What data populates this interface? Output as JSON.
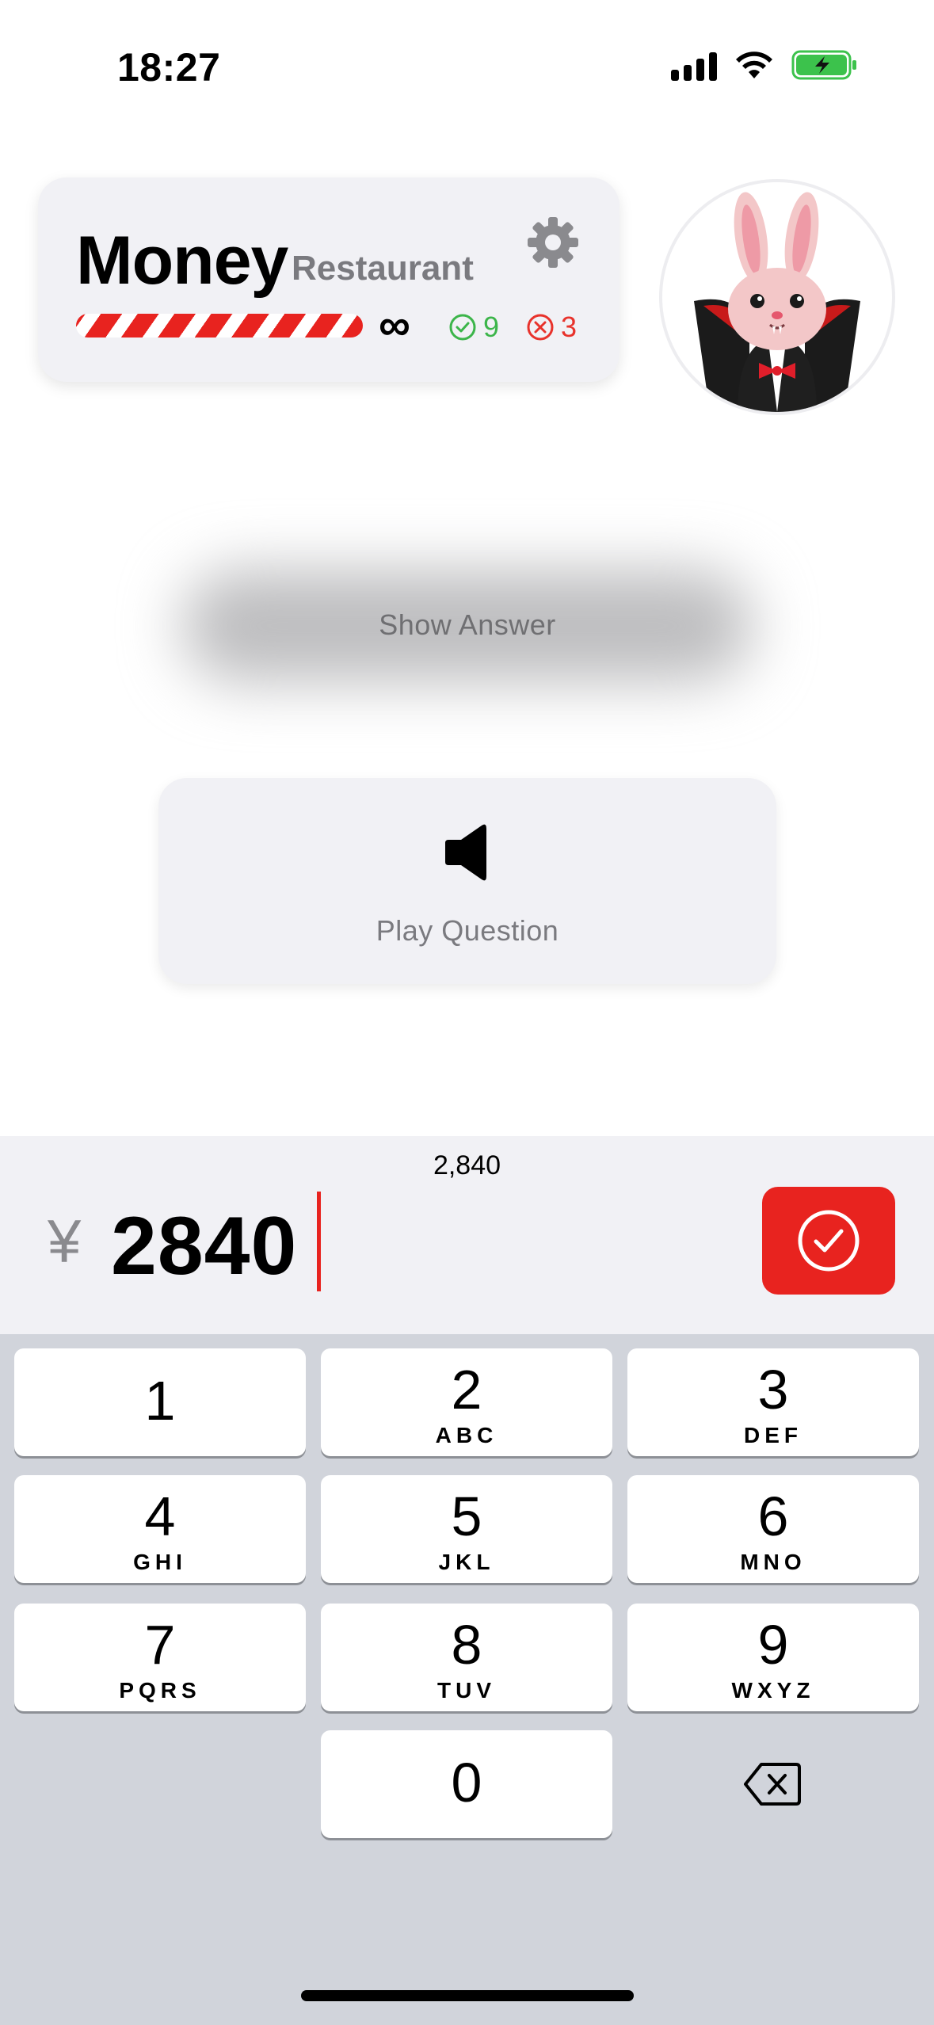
{
  "status_bar": {
    "time": "18:27",
    "battery": "charging"
  },
  "header": {
    "title": "Money",
    "subtitle": "Restaurant",
    "settings_icon": "gear-icon",
    "progress": 1.0,
    "lives": "∞",
    "correct_count": "9",
    "wrong_count": "3",
    "colors": {
      "accent": "#e8231f",
      "correct": "#3cb54a",
      "wrong": "#e8322b"
    }
  },
  "avatar": {
    "name": "bunny-vampire-avatar"
  },
  "show_answer": {
    "label": "Show Answer"
  },
  "play_question": {
    "label": "Play Question",
    "icon": "speaker-icon"
  },
  "input": {
    "formatted": "2,840",
    "currency": "¥",
    "value": "2840",
    "submit_icon": "checkmark-circle-icon"
  },
  "keypad": {
    "keys": [
      {
        "digit": "1",
        "letters": ""
      },
      {
        "digit": "2",
        "letters": "ABC"
      },
      {
        "digit": "3",
        "letters": "DEF"
      },
      {
        "digit": "4",
        "letters": "GHI"
      },
      {
        "digit": "5",
        "letters": "JKL"
      },
      {
        "digit": "6",
        "letters": "MNO"
      },
      {
        "digit": "7",
        "letters": "PQRS"
      },
      {
        "digit": "8",
        "letters": "TUV"
      },
      {
        "digit": "9",
        "letters": "WXYZ"
      },
      {
        "digit": "0",
        "letters": ""
      }
    ],
    "backspace_icon": "backspace-icon"
  }
}
